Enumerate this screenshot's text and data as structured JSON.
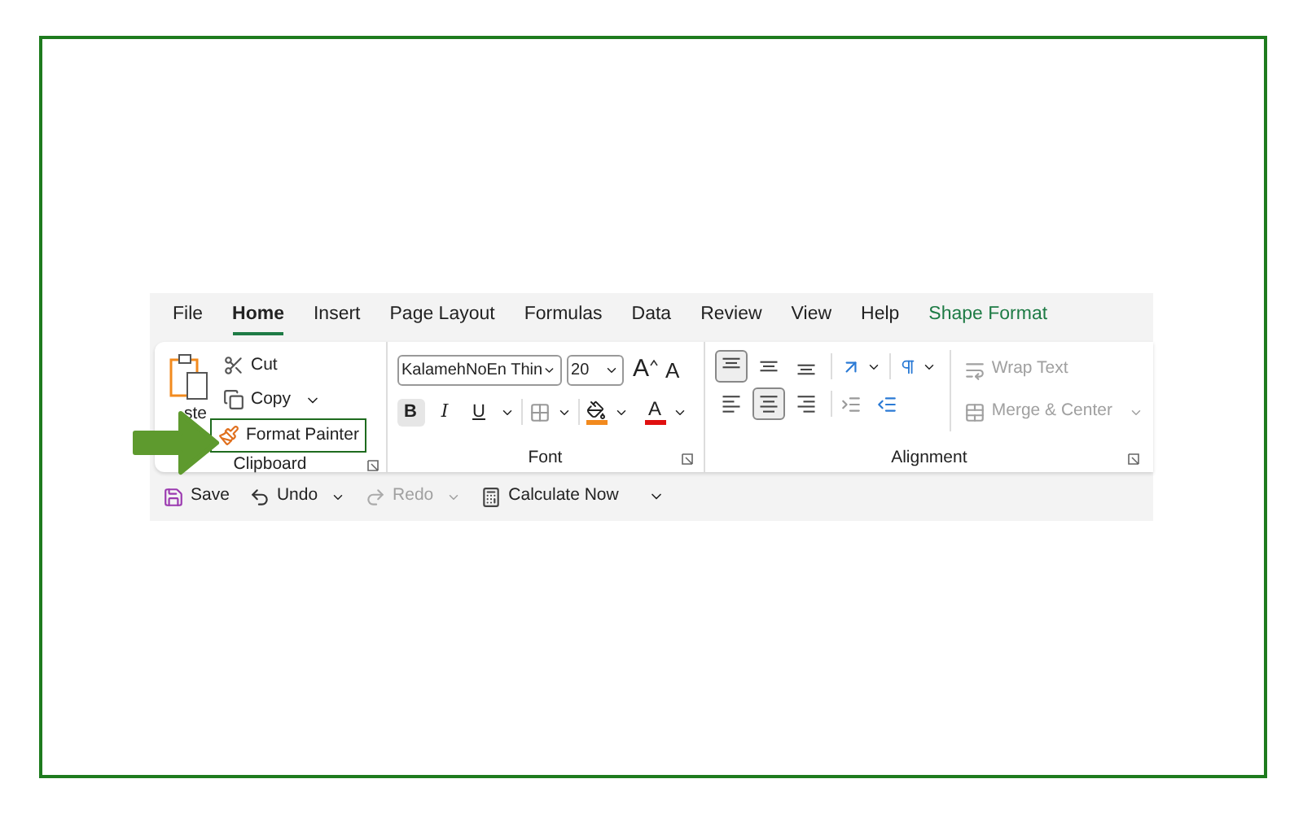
{
  "tabs": [
    {
      "label": "File",
      "selected": false,
      "kind": "normal"
    },
    {
      "label": "Home",
      "selected": true,
      "kind": "normal"
    },
    {
      "label": "Insert",
      "selected": false,
      "kind": "normal"
    },
    {
      "label": "Page Layout",
      "selected": false,
      "kind": "normal"
    },
    {
      "label": "Formulas",
      "selected": false,
      "kind": "normal"
    },
    {
      "label": "Data",
      "selected": false,
      "kind": "normal"
    },
    {
      "label": "Review",
      "selected": false,
      "kind": "normal"
    },
    {
      "label": "View",
      "selected": false,
      "kind": "normal"
    },
    {
      "label": "Help",
      "selected": false,
      "kind": "normal"
    },
    {
      "label": "Shape Format",
      "selected": false,
      "kind": "contextual"
    }
  ],
  "clipboard": {
    "label": "Clipboard",
    "paste_label": "ste",
    "cut": "Cut",
    "copy": "Copy",
    "format_painter": {
      "label": "Format Painter",
      "highlighted": true
    }
  },
  "font": {
    "label": "Font",
    "font_name": "KalamehNoEn Thin",
    "font_size": "20",
    "grow": "A",
    "shrink": "A",
    "color_letter": "A",
    "styles": [
      {
        "label": "B",
        "kind": "bold",
        "selected": true
      },
      {
        "label": "I",
        "kind": "italic",
        "selected": false
      },
      {
        "label": "U",
        "kind": "underline",
        "selected": false
      }
    ]
  },
  "alignment": {
    "label": "Alignment",
    "vertical": [
      {
        "kind": "top",
        "selected": true
      },
      {
        "kind": "middle",
        "selected": false
      },
      {
        "kind": "bottom",
        "selected": false
      }
    ],
    "horizontal": [
      {
        "kind": "left",
        "selected": false
      },
      {
        "kind": "center",
        "selected": true
      },
      {
        "kind": "right",
        "selected": false
      }
    ],
    "wrap_text": {
      "label": "Wrap Text",
      "disabled": true
    },
    "merge": {
      "label": "Merge & Center",
      "disabled": true
    }
  },
  "quick_access": [
    {
      "label": "Save",
      "kind": "save",
      "disabled": false,
      "dropdown": false
    },
    {
      "label": "Undo",
      "kind": "undo",
      "disabled": false,
      "dropdown": true
    },
    {
      "label": "Redo",
      "kind": "redo",
      "disabled": true,
      "dropdown": true
    },
    {
      "label": "Calculate Now",
      "kind": "calculate",
      "disabled": false,
      "dropdown": false
    }
  ]
}
